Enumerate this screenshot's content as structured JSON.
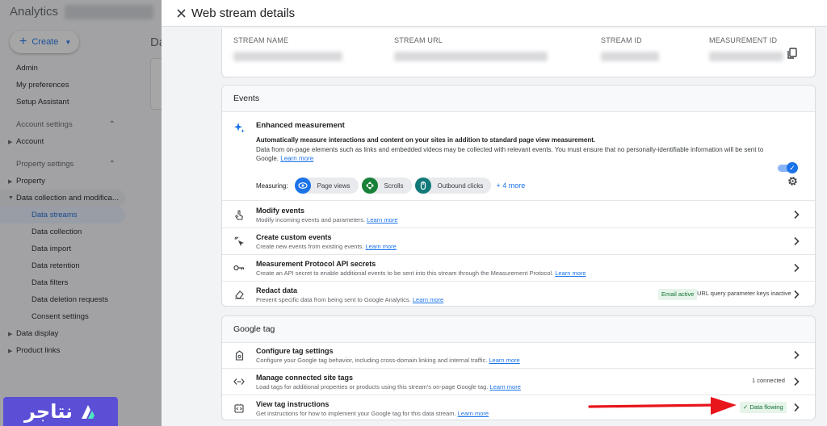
{
  "app": {
    "title": "Analytics",
    "create_label": "Create",
    "page_heading_fragment": "Da",
    "nav": [
      {
        "label": "Admin",
        "kind": "item"
      },
      {
        "label": "My preferences",
        "kind": "item"
      },
      {
        "label": "Setup Assistant",
        "kind": "item"
      },
      {
        "label": "Account settings",
        "kind": "section"
      },
      {
        "label": "Account",
        "kind": "expandable"
      },
      {
        "label": "Property settings",
        "kind": "section"
      },
      {
        "label": "Property",
        "kind": "expandable"
      },
      {
        "label": "Data collection and modifica...",
        "kind": "expanded"
      },
      {
        "label": "Data streams",
        "kind": "active"
      },
      {
        "label": "Data collection",
        "kind": "sub"
      },
      {
        "label": "Data import",
        "kind": "sub"
      },
      {
        "label": "Data retention",
        "kind": "sub"
      },
      {
        "label": "Data filters",
        "kind": "sub"
      },
      {
        "label": "Data deletion requests",
        "kind": "sub"
      },
      {
        "label": "Consent settings",
        "kind": "sub"
      },
      {
        "label": "Data display",
        "kind": "expandable"
      },
      {
        "label": "Product links",
        "kind": "expandable"
      }
    ]
  },
  "brand": {
    "text": "نتاجر",
    "color": "#5b4fd6"
  },
  "panel": {
    "title": "Web stream details",
    "stream": {
      "name_label": "STREAM NAME",
      "url_label": "STREAM URL",
      "id_label": "STREAM ID",
      "measurement_label": "MEASUREMENT ID"
    },
    "events": {
      "header": "Events",
      "enhanced": {
        "title": "Enhanced measurement",
        "desc1": "Automatically measure interactions and content on your sites in addition to standard page view measurement.",
        "desc2": "Data from on-page elements such as links and embedded videos may be collected with relevant events. You must ensure that no personally-identifiable information will be sent to Google.",
        "learn_more": "Learn more",
        "measuring_label": "Measuring:",
        "chips": [
          {
            "label": "Page views",
            "icon": "eye-icon",
            "color": "#1a73e8"
          },
          {
            "label": "Scrolls",
            "icon": "scroll-icon",
            "color": "#188038"
          },
          {
            "label": "Outbound clicks",
            "icon": "mouse-icon",
            "color": "#12797a"
          }
        ],
        "more": "+ 4 more",
        "enabled": true
      },
      "rows": [
        {
          "title": "Modify events",
          "desc": "Modify incoming events and parameters.",
          "link": "Learn more",
          "icon": "touch-icon"
        },
        {
          "title": "Create custom events",
          "desc": "Create new events from existing events.",
          "link": "Learn more",
          "icon": "sparkle-cursor-icon"
        },
        {
          "title": "Measurement Protocol API secrets",
          "desc": "Create an API secret to enable additional events to be sent into this stream through the Measurement Protocol.",
          "link": "Learn more",
          "icon": "key-icon"
        },
        {
          "title": "Redact data",
          "desc": "Prevent specific data from being sent to Google Analytics.",
          "link": "Learn more",
          "icon": "eraser-icon",
          "badge": "Email active",
          "note": "URL query parameter keys inactive"
        }
      ]
    },
    "gtag": {
      "header": "Google tag",
      "rows": [
        {
          "title": "Configure tag settings",
          "desc": "Configure your Google tag behavior, including cross-domain linking and internal traffic.",
          "link": "Learn more",
          "icon": "tag-settings-icon"
        },
        {
          "title": "Manage connected site tags",
          "desc": "Load tags for additional properties or products using this stream's on-page Google tag.",
          "link": "Learn more",
          "icon": "code-arrows-icon",
          "note": "1 connected"
        },
        {
          "title": "View tag instructions",
          "desc": "Get instructions for how to implement your Google tag for this data stream.",
          "link": "Learn more",
          "icon": "tag-code-icon",
          "badge": "Data flowing"
        }
      ]
    }
  },
  "colors": {
    "accent": "#1a73e8",
    "arrow": "#e8151b",
    "status_green": "#137333"
  }
}
